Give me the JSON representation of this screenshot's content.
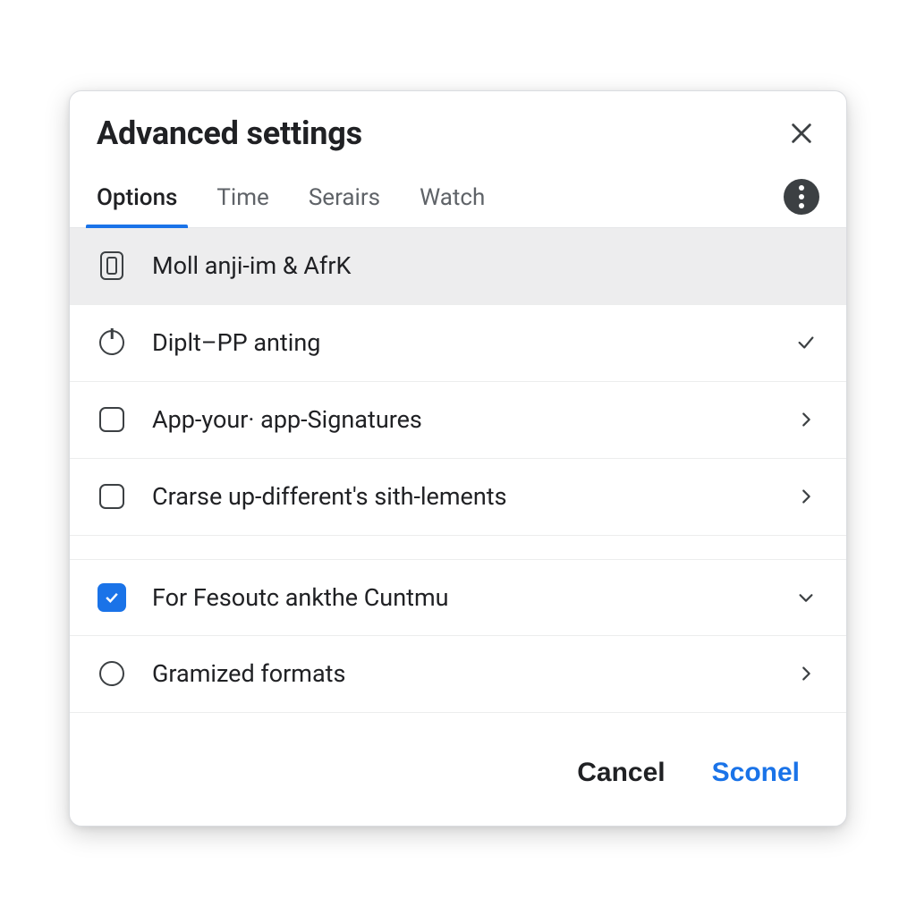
{
  "dialog": {
    "title": "Advanced settings"
  },
  "tabs": {
    "items": [
      {
        "label": "Options",
        "active": true
      },
      {
        "label": "Time",
        "active": false
      },
      {
        "label": "Serairs",
        "active": false
      },
      {
        "label": "Watch",
        "active": false
      }
    ]
  },
  "rows": [
    {
      "icon": "card-icon",
      "label": "Moll anji-im & AfrK",
      "trailing": "none",
      "selected": true
    },
    {
      "icon": "power-icon",
      "label": "Diplt–PP anting",
      "trailing": "check",
      "selected": false
    },
    {
      "icon": "box-icon",
      "label": "App-your· app-Signatures",
      "trailing": "chevron-right",
      "selected": false
    },
    {
      "icon": "box-icon",
      "label": "Crarse up-different's sith-lements",
      "trailing": "chevron-right",
      "selected": false
    },
    {
      "icon": "checkbox-checked-icon",
      "label": "For Fesoutc ankthe Cuntmu",
      "trailing": "chevron-down",
      "selected": false,
      "gap_above": true
    },
    {
      "icon": "circle-icon",
      "label": "Gramized formats",
      "trailing": "chevron-right",
      "selected": false
    }
  ],
  "footer": {
    "cancel": "Cancel",
    "confirm": "Sconel"
  },
  "colors": {
    "accent": "#1a73e8",
    "text": "#202124",
    "muted": "#5f6368",
    "border": "#e4e6e8"
  }
}
